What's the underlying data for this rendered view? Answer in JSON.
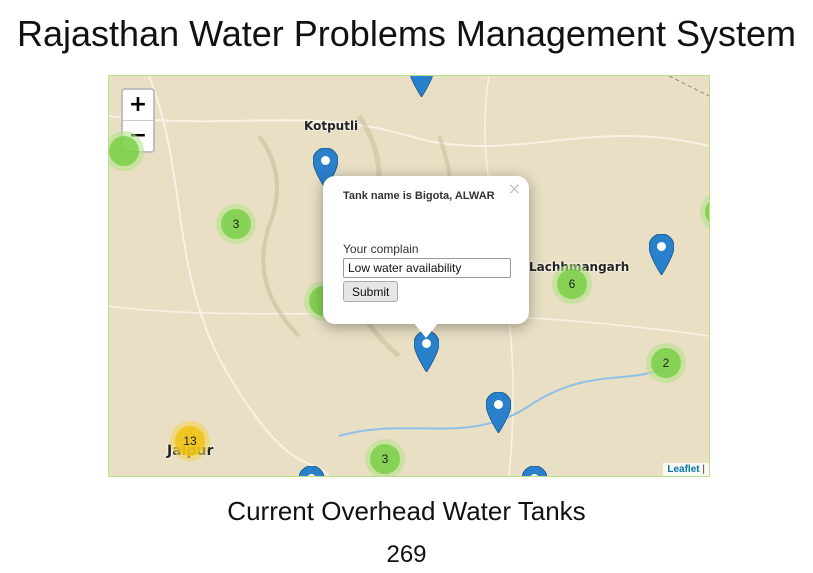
{
  "header": {
    "title": "Rajasthan Water Problems Management System"
  },
  "map": {
    "zoom_in": "+",
    "zoom_out": "−",
    "places": [
      {
        "key": "kotputli",
        "label": "Kotputli"
      },
      {
        "key": "lachhmangarh",
        "label": "Lachhmangarh"
      },
      {
        "key": "jaipur",
        "label": "Jaipur"
      }
    ],
    "clusters": [
      {
        "key": "c1",
        "count": "3"
      },
      {
        "key": "c2",
        "count": "6"
      },
      {
        "key": "c3",
        "count": "2"
      },
      {
        "key": "c4",
        "count": "13"
      },
      {
        "key": "c5",
        "count": "3"
      }
    ],
    "colors": {
      "marker": "#2a81cb",
      "cluster_green": "#6ecc39",
      "cluster_yellow": "#f0c20c",
      "water": "#a9d3f0"
    },
    "attribution": {
      "link": "Leaflet",
      "sep": " |"
    }
  },
  "popup": {
    "title": "Tank name is Bigota, ALWAR",
    "close": "×",
    "complaint_label": "Your complain",
    "complaint_value": "Low water availability",
    "submit_label": "Submit"
  },
  "footer": {
    "label": "Current Overhead Water Tanks",
    "count": "269"
  }
}
